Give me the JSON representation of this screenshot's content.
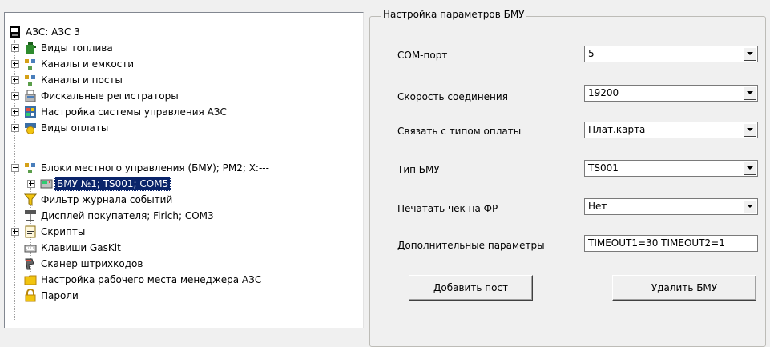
{
  "tree": {
    "items": [
      {
        "label": "АЗС: АЗС 3",
        "icon": "station-icon",
        "expander": "none"
      },
      {
        "label": "Виды топлива",
        "icon": "fuel-can-icon",
        "expander": "plus"
      },
      {
        "label": "Каналы и емкости",
        "icon": "network-icon",
        "expander": "plus"
      },
      {
        "label": "Каналы и посты",
        "icon": "network-icon",
        "expander": "plus"
      },
      {
        "label": "Фискальные регистраторы",
        "icon": "cash-register-icon",
        "expander": "plus"
      },
      {
        "label": "Настройка системы управления АЗС",
        "icon": "control-panel-icon",
        "expander": "plus"
      },
      {
        "label": "Виды оплаты",
        "icon": "payment-icon",
        "expander": "plus"
      },
      {
        "label": "Блоки местного управления (БМУ);  РМ2;  Х:---",
        "icon": "network-icon",
        "expander": "minus"
      },
      {
        "label": "БМУ №1; TS001; COM5",
        "icon": "device-icon",
        "expander": "plus",
        "selected": true
      },
      {
        "label": "Фильтр журнала событий",
        "icon": "filter-icon",
        "expander": "none"
      },
      {
        "label": "Дисплей покупателя; Firich; COM3",
        "icon": "display-icon",
        "expander": "none"
      },
      {
        "label": "Скрипты",
        "icon": "script-icon",
        "expander": "plus"
      },
      {
        "label": "Клавиши GasKit",
        "icon": "keyboard-icon",
        "expander": "none"
      },
      {
        "label": "Сканер штрихкодов",
        "icon": "barcode-scanner-icon",
        "expander": "none"
      },
      {
        "label": "Настройка рабочего места менеджера АЗС",
        "icon": "folder-icon",
        "expander": "none"
      },
      {
        "label": "Пароли",
        "icon": "lock-icon",
        "expander": "none"
      }
    ]
  },
  "settings": {
    "title": "Настройка параметров БМУ",
    "com_port": {
      "label": "COM-порт",
      "value": "5"
    },
    "speed": {
      "label": "Скорость соединения",
      "value": "19200"
    },
    "payment": {
      "label": "Связать с типом оплаты",
      "value": "Плат.карта"
    },
    "bmu_type": {
      "label": "Тип БМУ",
      "value": "TS001"
    },
    "print_receipt": {
      "label": "Печатать чек на ФР",
      "value": "Нет"
    },
    "extra": {
      "label": "Дополнительные параметры",
      "value": "TIMEOUT1=30 TIMEOUT2=1"
    },
    "add_button": "Добавить пост",
    "delete_button": "Удалить БМУ"
  },
  "colors": {
    "selection": "#0a246a",
    "window_bg": "#f0f0f0"
  }
}
